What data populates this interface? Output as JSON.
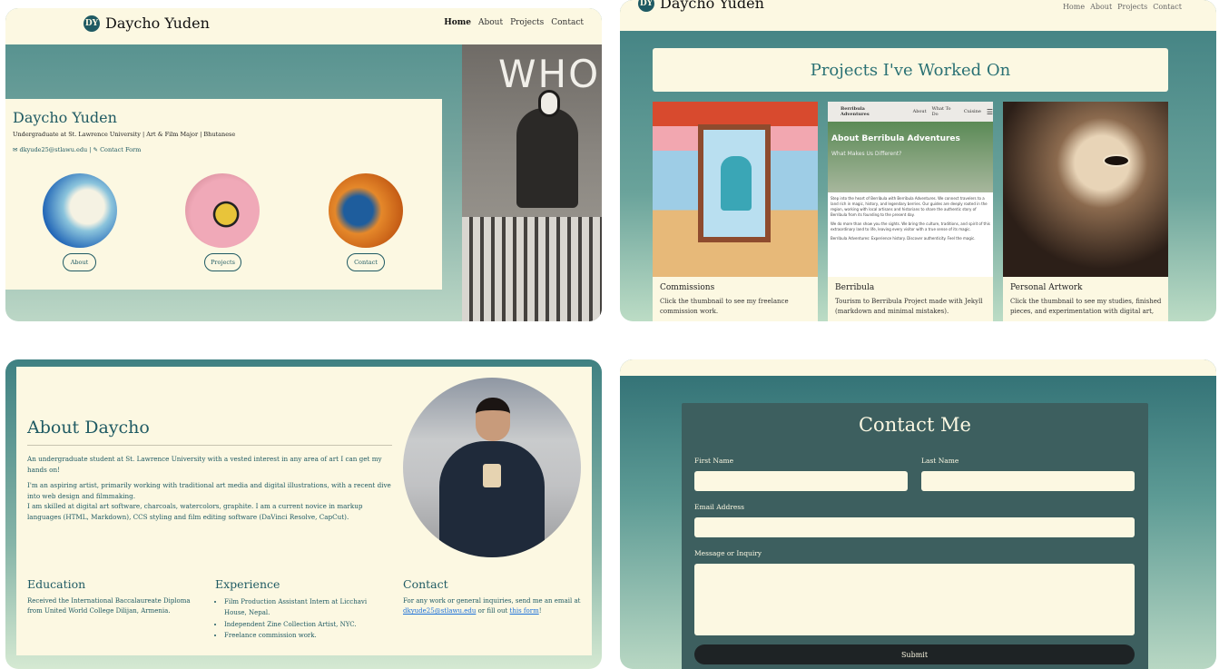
{
  "header": {
    "brand": "Daycho Yuden",
    "logo_text": "DY",
    "nav": [
      "Home",
      "About",
      "Projects",
      "Contact"
    ]
  },
  "hero": {
    "name": "Daycho Yuden",
    "subtitle": "Undergraduate at St. Lawrence University | Art & Film Major | Bhutanese",
    "email": "dkyude25@stlawu.edu",
    "separator": "|",
    "contact_form": "Contact Form",
    "buttons": [
      "About",
      "Projects",
      "Contact"
    ],
    "art_text": "WHO"
  },
  "projects": {
    "title": "Projects I've Worked On",
    "cards": [
      {
        "title": "Commissions",
        "desc": "Click the thumbnail to see my freelance commission work."
      },
      {
        "title": "Berribula",
        "desc": "Tourism to Berribula Project made with Jekyll (markdown and minimal mistakes)."
      },
      {
        "title": "Personal Artwork",
        "desc": "Click the thumbnail to see my studies, finished pieces, and experimentation with digital art,"
      }
    ],
    "berribula_thumb": {
      "site_name": "Berribula Adventures",
      "nav": [
        "About",
        "What To Do",
        "Cuisine"
      ],
      "heading": "About Berribula Adventures",
      "subheading": "What Makes Us Different?",
      "body1": "Step into the heart of Berribula with Berribula Adventures. We connect travelers to a land rich in magic, history, and legendary berries. Our guides are deeply rooted in the region, working with local artisans and historians to share the authentic story of Berribula from its founding to the present day.",
      "body2": "We do more than show you the sights. We bring the culture, traditions, and spirit of this extraordinary land to life, leaving every visitor with a true sense of its magic.",
      "body3": "Berribula Adventures: Experience history. Discover authenticity. Feel the magic."
    }
  },
  "about": {
    "title": "About Daycho",
    "p1": "An undergraduate student at St. Lawrence University with a vested interest in any area of art I can get my hands on!",
    "p2": "I'm an aspiring artist, primarily working with traditional art media and digital illustrations, with a recent dive into web design and filmmaking.",
    "p3": "I am skilled at digital art software, charcoals, watercolors, graphite. I am a current novice in markup languages (HTML, Markdown), CCS styling and film editing software (DaVinci Resolve, CapCut).",
    "education": {
      "title": "Education",
      "body": "Received the International Baccalaureate Diploma from United World College Dilijan, Armenia."
    },
    "experience": {
      "title": "Experience",
      "items": [
        "Film Production Assistant Intern at Licchavi House, Nepal.",
        "Independent Zine Collection Artist, NYC.",
        "Freelance commission work."
      ]
    },
    "contact": {
      "title": "Contact",
      "body_start": "For any work or general inquiries, send me an email at ",
      "email": "dkyude25@stlawu.edu",
      "middle": " or fill out ",
      "link": "this form",
      "end": "!"
    }
  },
  "contact_form": {
    "title": "Contact Me",
    "first_name": "First Name",
    "last_name": "Last Name",
    "email": "Email Address",
    "message": "Message or Inquiry",
    "submit": "Submit"
  }
}
